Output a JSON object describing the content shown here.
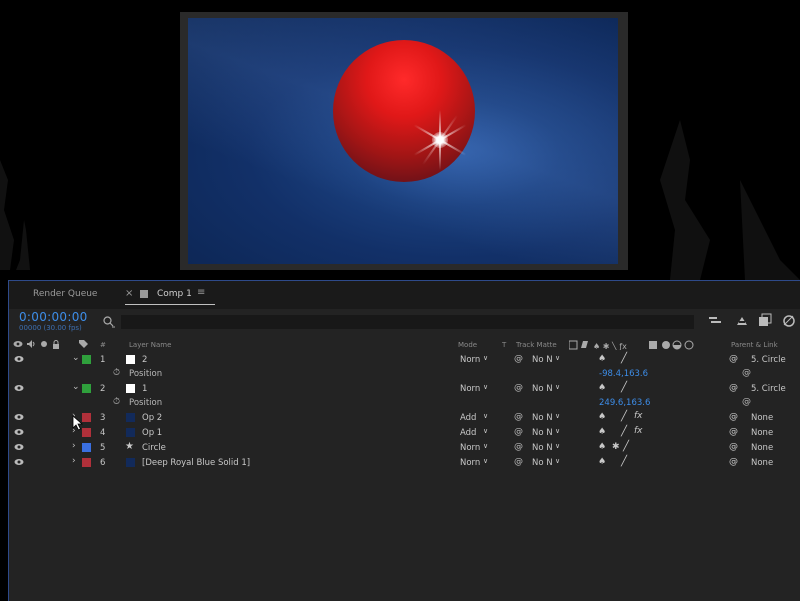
{
  "tabs": {
    "render_queue": "Render Queue",
    "close": "×",
    "comp": "Comp 1",
    "menu": "≡"
  },
  "timecode": "0:00:00:00",
  "fps": "00000 (30.00 fps)",
  "columns": {
    "layer_name": "Layer Name",
    "mode": "Mode",
    "t": "T",
    "track_matte": "Track Matte",
    "parent_link": "Parent & Link",
    "hash": "#"
  },
  "layers": [
    {
      "num": "1",
      "name": "2",
      "label_color": "#2fa03c",
      "source": "white",
      "expanded": true,
      "mode": "Norn",
      "matte": "No N",
      "fx": false,
      "parent": "5. Circle",
      "property": {
        "name": "Position",
        "value": "-98.4,163.6"
      }
    },
    {
      "num": "2",
      "name": "1",
      "label_color": "#2fa03c",
      "source": "white",
      "expanded": true,
      "mode": "Norn",
      "matte": "No N",
      "fx": false,
      "parent": "5. Circle",
      "property": {
        "name": "Position",
        "value": "249.6,163.6"
      }
    },
    {
      "num": "3",
      "name": "Op 2",
      "label_color": "#b0303a",
      "source": "navy",
      "expanded": false,
      "mode": "Add",
      "matte": "No N",
      "fx": true,
      "parent": "None"
    },
    {
      "num": "4",
      "name": "Op 1",
      "label_color": "#b0303a",
      "source": "navy",
      "expanded": false,
      "mode": "Add",
      "matte": "No N",
      "fx": true,
      "parent": "None"
    },
    {
      "num": "5",
      "name": "Circle",
      "label_color": "#3a6fe0",
      "source": "star",
      "expanded": false,
      "mode": "Norn",
      "matte": "No N",
      "fx": false,
      "parent": "None"
    },
    {
      "num": "6",
      "name": "[Deep Royal Blue Solid 1]",
      "label_color": "#b0303a",
      "source": "navy",
      "expanded": false,
      "mode": "Norn",
      "matte": "No N",
      "fx": false,
      "parent": "None"
    }
  ],
  "colors": {
    "accent": "#3d8de8",
    "panel": "#232323",
    "preview_bg": "#123068",
    "sphere": "#e01818"
  }
}
